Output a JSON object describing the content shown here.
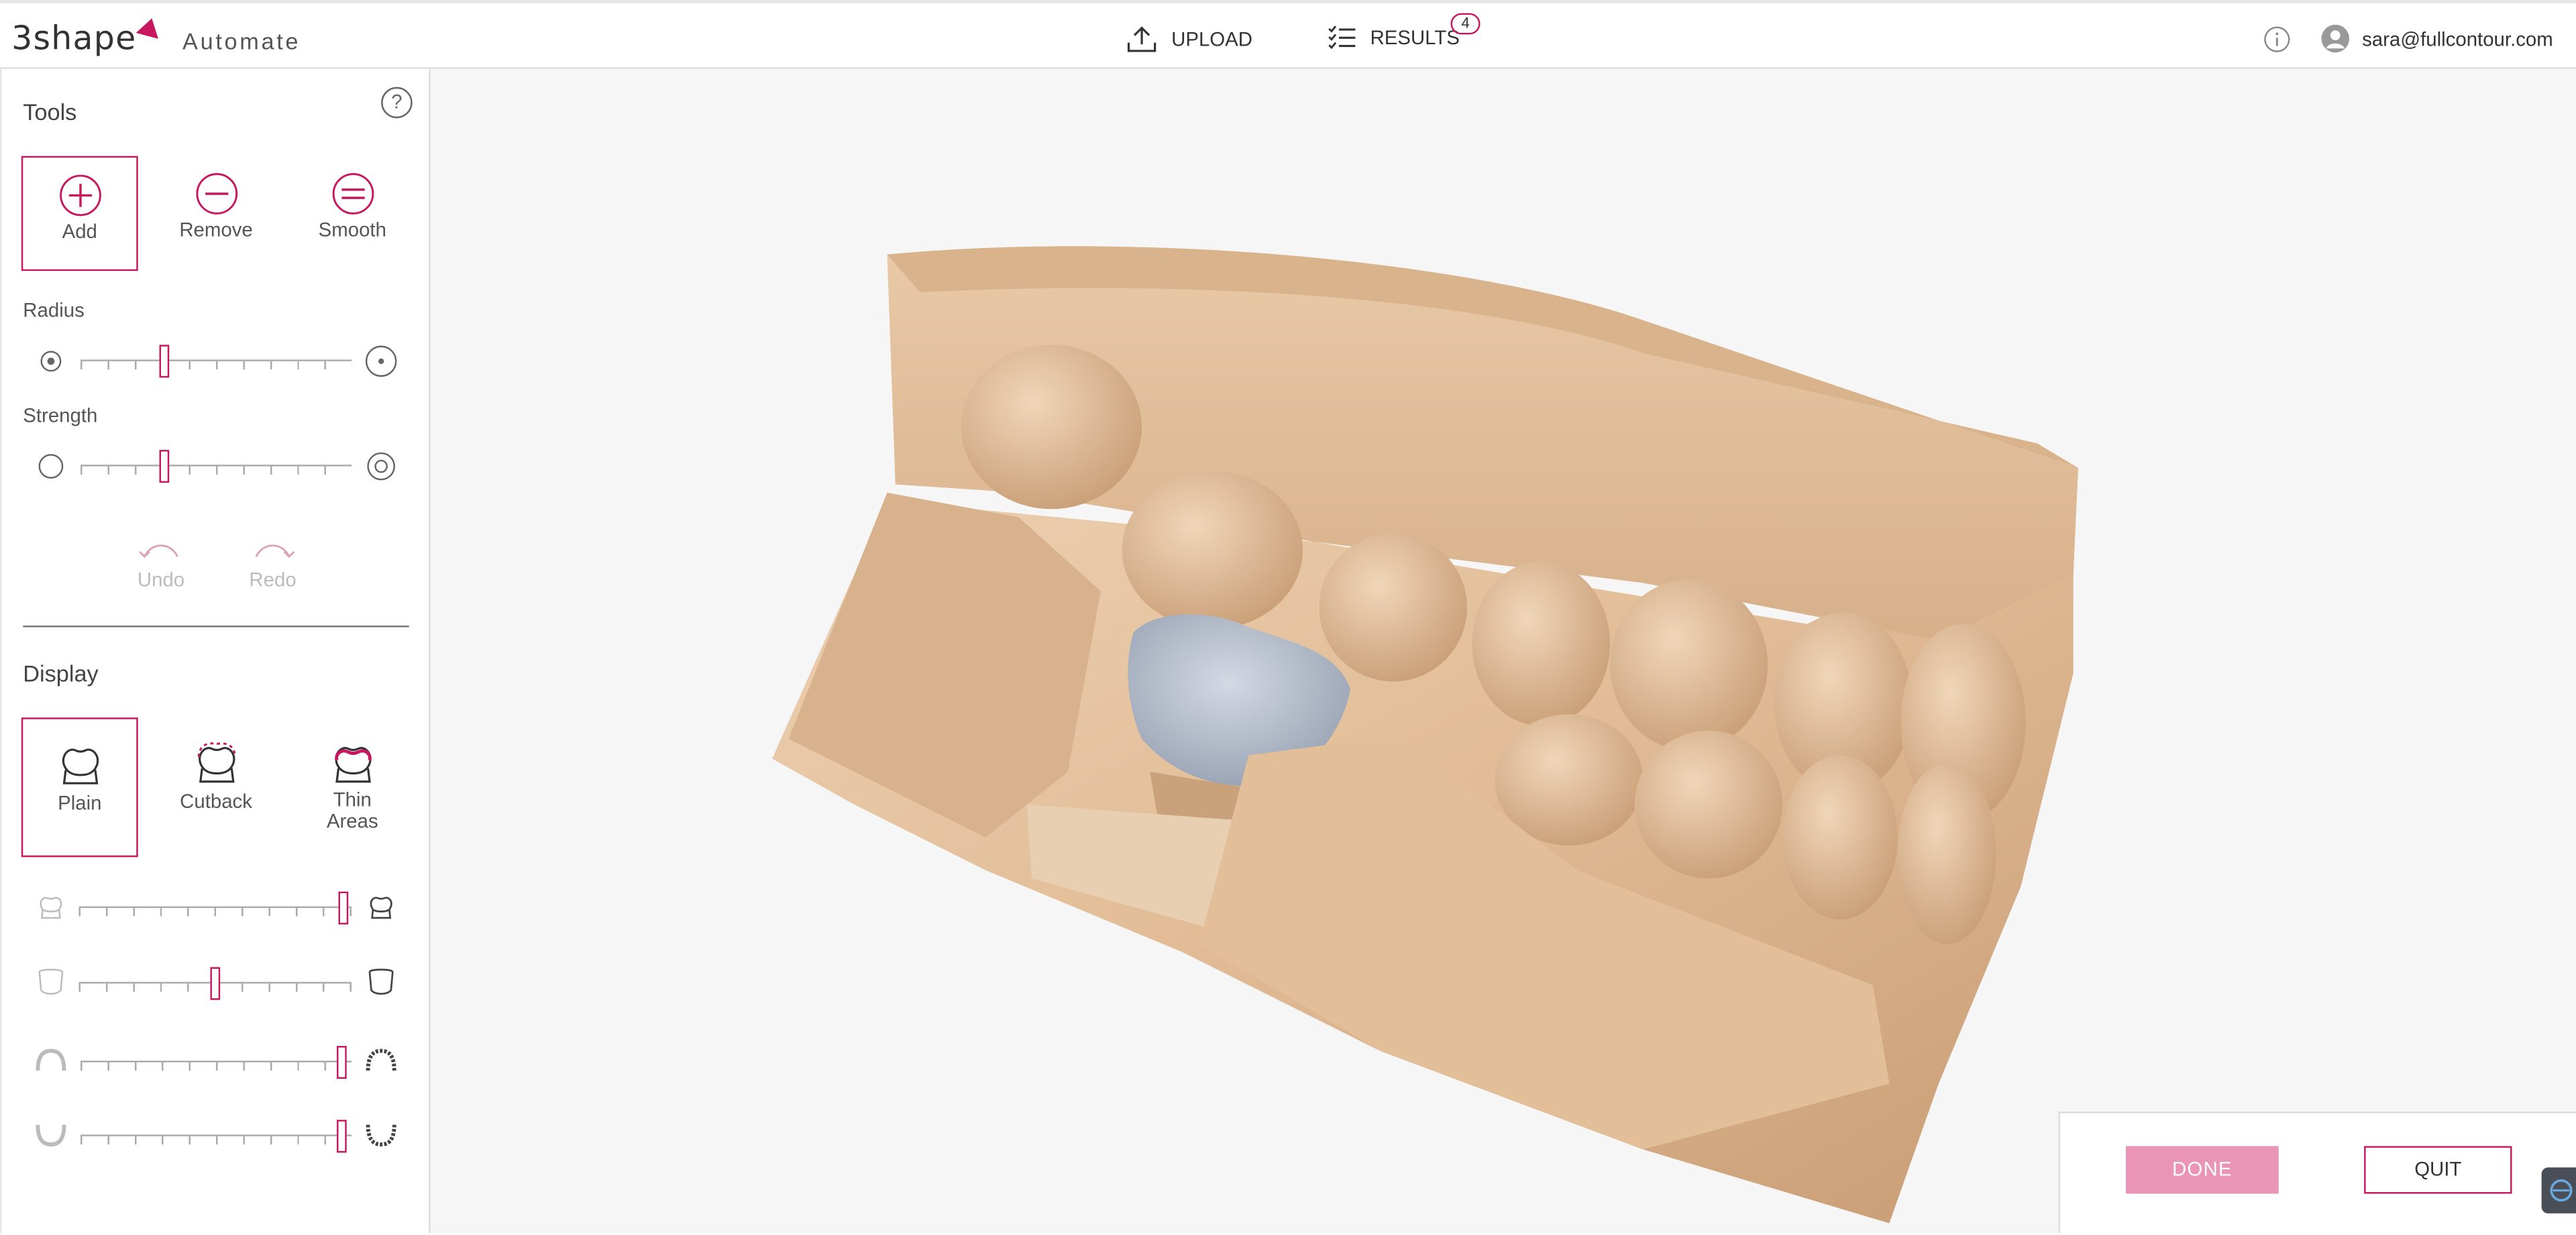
{
  "header": {
    "brand": "3shape",
    "app_name": "Automate",
    "nav": [
      {
        "label": "UPLOAD",
        "icon": "upload-icon"
      },
      {
        "label": "RESULTS",
        "icon": "results-list-icon",
        "badge": "4"
      }
    ],
    "info_icon": "info-icon",
    "user": {
      "email": "sara@fullcontour.com",
      "icon": "user-avatar-icon"
    }
  },
  "tools": {
    "title": "Tools",
    "help": "?",
    "items": [
      {
        "label": "Add",
        "icon": "add-icon",
        "selected": true
      },
      {
        "label": "Remove",
        "icon": "remove-icon",
        "selected": false
      },
      {
        "label": "Smooth",
        "icon": "smooth-icon",
        "selected": false
      }
    ],
    "radius": {
      "label": "Radius",
      "level": 0.3
    },
    "strength": {
      "label": "Strength",
      "level": 0.3
    },
    "undo": "Undo",
    "redo": "Redo"
  },
  "display": {
    "title": "Display",
    "items": [
      {
        "label": "Plain",
        "icon": "plain-tooth-icon",
        "selected": true
      },
      {
        "label": "Cutback",
        "icon": "cutback-tooth-icon",
        "selected": false
      },
      {
        "label": "Thin Areas",
        "icon": "thin-areas-tooth-icon",
        "selected": false
      }
    ],
    "sliders": [
      {
        "name": "crown-transparency",
        "level": 0.99
      },
      {
        "name": "preparation-transparency",
        "level": 0.5
      },
      {
        "name": "upper-jaw-transparency",
        "level": 0.98
      },
      {
        "name": "lower-jaw-transparency",
        "level": 0.98
      }
    ]
  },
  "actions": {
    "done": "DONE",
    "quit": "QUIT"
  },
  "colors": {
    "accent": "#c8175f",
    "done_bg": "#ea95b6",
    "model": "#e6c3a0",
    "crown": "#b5bdcb"
  }
}
